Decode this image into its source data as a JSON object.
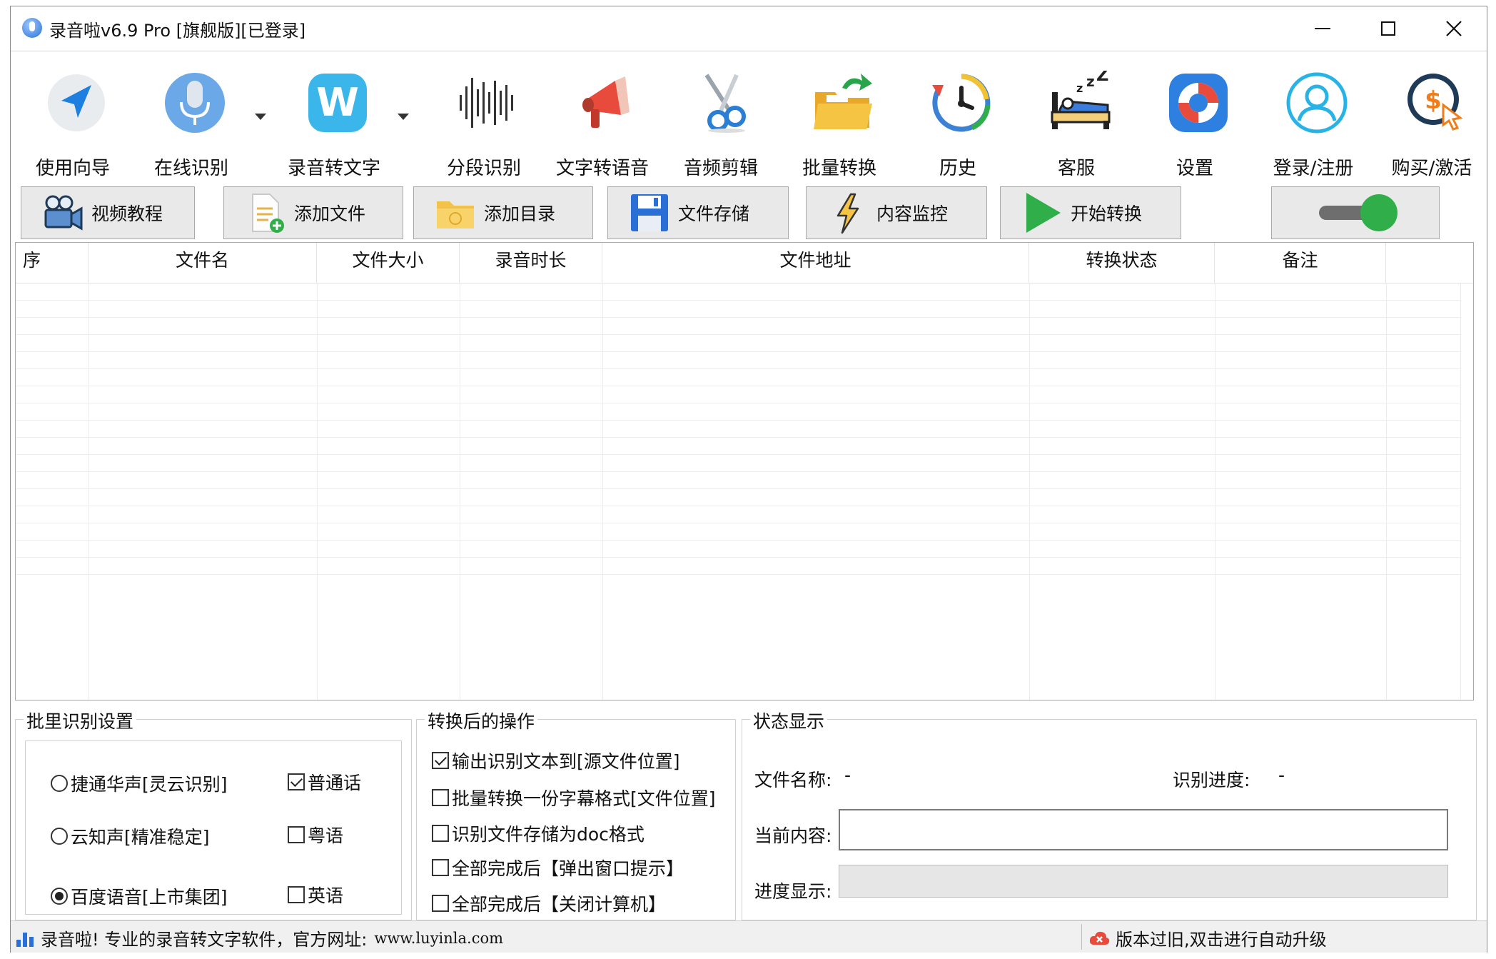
{
  "window": {
    "title": "录音啦v6.9 Pro [旗舰版][已登录]"
  },
  "toolbar": {
    "items": [
      {
        "label": "使用向导",
        "icon": "navigation-arrow-icon"
      },
      {
        "label": "在线识别",
        "icon": "microphone-icon"
      },
      {
        "label": "录音转文字",
        "icon": "word-w-icon"
      },
      {
        "label": "分段识别",
        "icon": "waveform-icon"
      },
      {
        "label": "文字转语音",
        "icon": "megaphone-icon"
      },
      {
        "label": "音频剪辑",
        "icon": "scissors-icon"
      },
      {
        "label": "批量转换",
        "icon": "folder-arrow-icon"
      },
      {
        "label": "历史",
        "icon": "history-clock-icon"
      },
      {
        "label": "客服",
        "icon": "sleeping-bed-icon"
      },
      {
        "label": "设置",
        "icon": "lifebuoy-icon"
      },
      {
        "label": "登录/注册",
        "icon": "user-icon"
      },
      {
        "label": "购买/激活",
        "icon": "dollar-cursor-icon"
      }
    ]
  },
  "buttons": {
    "video_tutorial": "视频教程",
    "add_file": "添加文件",
    "add_folder": "添加目录",
    "file_storage": "文件存储",
    "content_monitor": "内容监控",
    "start_convert": "开始转换"
  },
  "table": {
    "columns": [
      "序",
      "文件名",
      "文件大小",
      "录音时长",
      "文件地址",
      "转换状态",
      "备注"
    ],
    "rows": []
  },
  "batch_settings": {
    "title": "批里识别设置",
    "engines": [
      {
        "label": "捷通华声[灵云识别]",
        "selected": false
      },
      {
        "label": "云知声[精准稳定]",
        "selected": false
      },
      {
        "label": "百度语音[上市集团]",
        "selected": true
      }
    ],
    "languages": [
      {
        "label": "普通话",
        "checked": true
      },
      {
        "label": "粤语",
        "checked": false
      },
      {
        "label": "英语",
        "checked": false
      }
    ]
  },
  "post_actions": {
    "title": "转换后的操作",
    "options": [
      {
        "label": "输出识别文本到[源文件位置]",
        "checked": true
      },
      {
        "label": "批量转换一份字幕格式[文件位置]",
        "checked": false
      },
      {
        "label": "识别文件存储为doc格式",
        "checked": false
      },
      {
        "label": "全部完成后【弹出窗口提示】",
        "checked": false
      },
      {
        "label": "全部完成后【关闭计算机】",
        "checked": false
      }
    ]
  },
  "status": {
    "title": "状态显示",
    "file_name_label": "文件名称:",
    "file_name_value": "-",
    "progress_label": "识别进度:",
    "progress_value": "-",
    "current_content_label": "当前内容:",
    "current_content_value": "",
    "progress_display_label": "进度显示:",
    "progress_fraction": 0
  },
  "statusbar": {
    "left_text": "录音啦! 专业的录音转文字软件，官方网址:",
    "left_url": "www.luyinla.com",
    "right_text": "版本过旧,双击进行自动升级"
  },
  "colors": {
    "accent_green": "#2fae49",
    "toolbar_blue": "#2a6fd6"
  }
}
